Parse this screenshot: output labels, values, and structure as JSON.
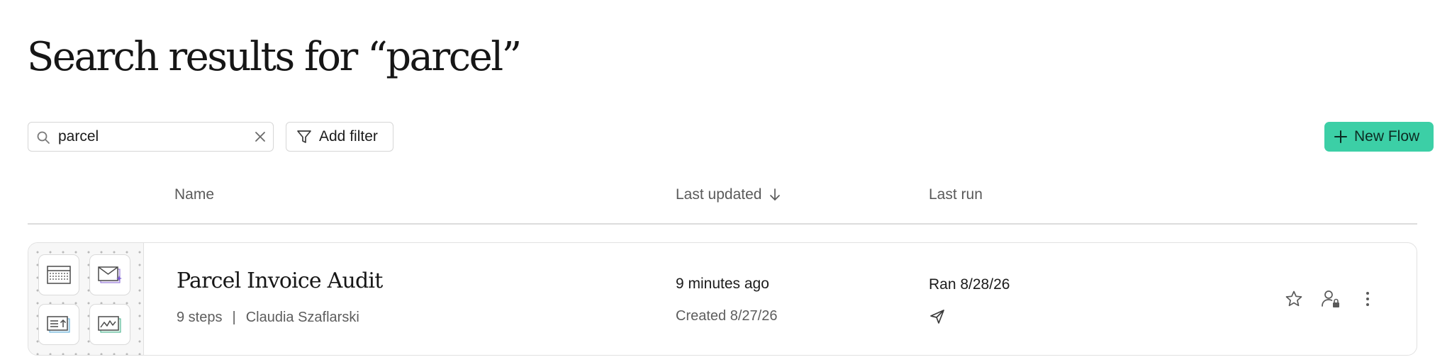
{
  "page": {
    "title": "Search results for “parcel”"
  },
  "toolbar": {
    "search_value": "parcel",
    "search_placeholder": "Search",
    "add_filter_label": "Add filter",
    "new_flow_label": "New Flow",
    "new_flow_color": "#3ccfa6"
  },
  "table": {
    "columns": {
      "name": "Name",
      "last_updated": "Last updated",
      "last_run": "Last run"
    },
    "sort": {
      "column": "Last updated",
      "direction": "descending"
    },
    "rows": [
      {
        "name": "Parcel Invoice Audit",
        "steps": "9 steps",
        "separator": "|",
        "owner": "Claudia Szaflarski",
        "updated": "9 minutes ago",
        "created": "Created 8/27/26",
        "last_run": "Ran 8/28/26",
        "step_icons": [
          "table-icon",
          "mail-sparkle-icon",
          "list-upload-icon",
          "chart-icon"
        ],
        "trigger_icon": "send-icon",
        "actions": [
          "star-icon",
          "user-lock-icon",
          "more-vertical-icon"
        ]
      }
    ]
  }
}
